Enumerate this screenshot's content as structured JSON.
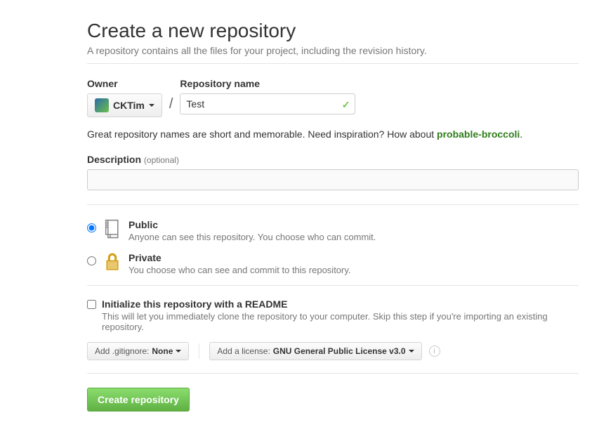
{
  "header": {
    "title": "Create a new repository",
    "subtitle": "A repository contains all the files for your project, including the revision history."
  },
  "owner": {
    "label": "Owner",
    "name": "CKTim"
  },
  "repo": {
    "label": "Repository name",
    "value": "Test"
  },
  "hint": {
    "text_prefix": "Great repository names are short and memorable. Need inspiration? How about ",
    "suggestion": "probable-broccoli",
    "text_suffix": "."
  },
  "description": {
    "label": "Description",
    "optional": "(optional)",
    "value": ""
  },
  "visibility": {
    "public": {
      "title": "Public",
      "sub": "Anyone can see this repository. You choose who can commit.",
      "selected": true
    },
    "private": {
      "title": "Private",
      "sub": "You choose who can see and commit to this repository.",
      "selected": false
    }
  },
  "init": {
    "label": "Initialize this repository with a README",
    "sub": "This will let you immediately clone the repository to your computer. Skip this step if you're importing an existing repository.",
    "checked": false
  },
  "gitignore": {
    "prefix": "Add .gitignore: ",
    "value": "None"
  },
  "license": {
    "prefix": "Add a license: ",
    "value": "GNU General Public License v3.0"
  },
  "submit": {
    "label": "Create repository"
  }
}
